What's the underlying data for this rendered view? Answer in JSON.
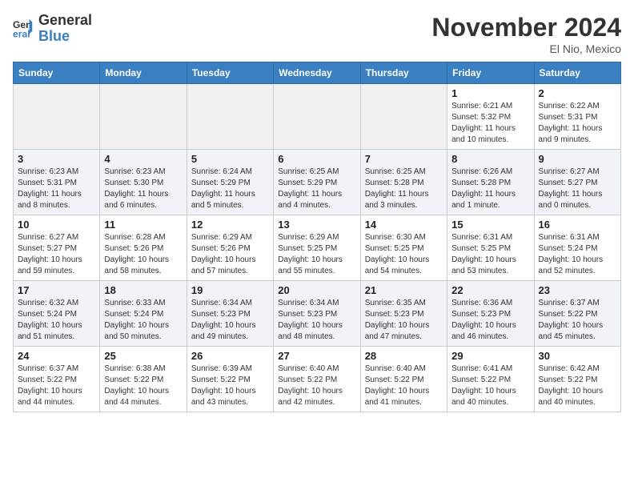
{
  "header": {
    "logo_line1": "General",
    "logo_line2": "Blue",
    "month": "November 2024",
    "location": "El Nio, Mexico"
  },
  "days_of_week": [
    "Sunday",
    "Monday",
    "Tuesday",
    "Wednesday",
    "Thursday",
    "Friday",
    "Saturday"
  ],
  "weeks": [
    [
      {
        "day": "",
        "info": ""
      },
      {
        "day": "",
        "info": ""
      },
      {
        "day": "",
        "info": ""
      },
      {
        "day": "",
        "info": ""
      },
      {
        "day": "",
        "info": ""
      },
      {
        "day": "1",
        "info": "Sunrise: 6:21 AM\nSunset: 5:32 PM\nDaylight: 11 hours and 10 minutes."
      },
      {
        "day": "2",
        "info": "Sunrise: 6:22 AM\nSunset: 5:31 PM\nDaylight: 11 hours and 9 minutes."
      }
    ],
    [
      {
        "day": "3",
        "info": "Sunrise: 6:23 AM\nSunset: 5:31 PM\nDaylight: 11 hours and 8 minutes."
      },
      {
        "day": "4",
        "info": "Sunrise: 6:23 AM\nSunset: 5:30 PM\nDaylight: 11 hours and 6 minutes."
      },
      {
        "day": "5",
        "info": "Sunrise: 6:24 AM\nSunset: 5:29 PM\nDaylight: 11 hours and 5 minutes."
      },
      {
        "day": "6",
        "info": "Sunrise: 6:25 AM\nSunset: 5:29 PM\nDaylight: 11 hours and 4 minutes."
      },
      {
        "day": "7",
        "info": "Sunrise: 6:25 AM\nSunset: 5:28 PM\nDaylight: 11 hours and 3 minutes."
      },
      {
        "day": "8",
        "info": "Sunrise: 6:26 AM\nSunset: 5:28 PM\nDaylight: 11 hours and 1 minute."
      },
      {
        "day": "9",
        "info": "Sunrise: 6:27 AM\nSunset: 5:27 PM\nDaylight: 11 hours and 0 minutes."
      }
    ],
    [
      {
        "day": "10",
        "info": "Sunrise: 6:27 AM\nSunset: 5:27 PM\nDaylight: 10 hours and 59 minutes."
      },
      {
        "day": "11",
        "info": "Sunrise: 6:28 AM\nSunset: 5:26 PM\nDaylight: 10 hours and 58 minutes."
      },
      {
        "day": "12",
        "info": "Sunrise: 6:29 AM\nSunset: 5:26 PM\nDaylight: 10 hours and 57 minutes."
      },
      {
        "day": "13",
        "info": "Sunrise: 6:29 AM\nSunset: 5:25 PM\nDaylight: 10 hours and 55 minutes."
      },
      {
        "day": "14",
        "info": "Sunrise: 6:30 AM\nSunset: 5:25 PM\nDaylight: 10 hours and 54 minutes."
      },
      {
        "day": "15",
        "info": "Sunrise: 6:31 AM\nSunset: 5:25 PM\nDaylight: 10 hours and 53 minutes."
      },
      {
        "day": "16",
        "info": "Sunrise: 6:31 AM\nSunset: 5:24 PM\nDaylight: 10 hours and 52 minutes."
      }
    ],
    [
      {
        "day": "17",
        "info": "Sunrise: 6:32 AM\nSunset: 5:24 PM\nDaylight: 10 hours and 51 minutes."
      },
      {
        "day": "18",
        "info": "Sunrise: 6:33 AM\nSunset: 5:24 PM\nDaylight: 10 hours and 50 minutes."
      },
      {
        "day": "19",
        "info": "Sunrise: 6:34 AM\nSunset: 5:23 PM\nDaylight: 10 hours and 49 minutes."
      },
      {
        "day": "20",
        "info": "Sunrise: 6:34 AM\nSunset: 5:23 PM\nDaylight: 10 hours and 48 minutes."
      },
      {
        "day": "21",
        "info": "Sunrise: 6:35 AM\nSunset: 5:23 PM\nDaylight: 10 hours and 47 minutes."
      },
      {
        "day": "22",
        "info": "Sunrise: 6:36 AM\nSunset: 5:23 PM\nDaylight: 10 hours and 46 minutes."
      },
      {
        "day": "23",
        "info": "Sunrise: 6:37 AM\nSunset: 5:22 PM\nDaylight: 10 hours and 45 minutes."
      }
    ],
    [
      {
        "day": "24",
        "info": "Sunrise: 6:37 AM\nSunset: 5:22 PM\nDaylight: 10 hours and 44 minutes."
      },
      {
        "day": "25",
        "info": "Sunrise: 6:38 AM\nSunset: 5:22 PM\nDaylight: 10 hours and 44 minutes."
      },
      {
        "day": "26",
        "info": "Sunrise: 6:39 AM\nSunset: 5:22 PM\nDaylight: 10 hours and 43 minutes."
      },
      {
        "day": "27",
        "info": "Sunrise: 6:40 AM\nSunset: 5:22 PM\nDaylight: 10 hours and 42 minutes."
      },
      {
        "day": "28",
        "info": "Sunrise: 6:40 AM\nSunset: 5:22 PM\nDaylight: 10 hours and 41 minutes."
      },
      {
        "day": "29",
        "info": "Sunrise: 6:41 AM\nSunset: 5:22 PM\nDaylight: 10 hours and 40 minutes."
      },
      {
        "day": "30",
        "info": "Sunrise: 6:42 AM\nSunset: 5:22 PM\nDaylight: 10 hours and 40 minutes."
      }
    ]
  ]
}
